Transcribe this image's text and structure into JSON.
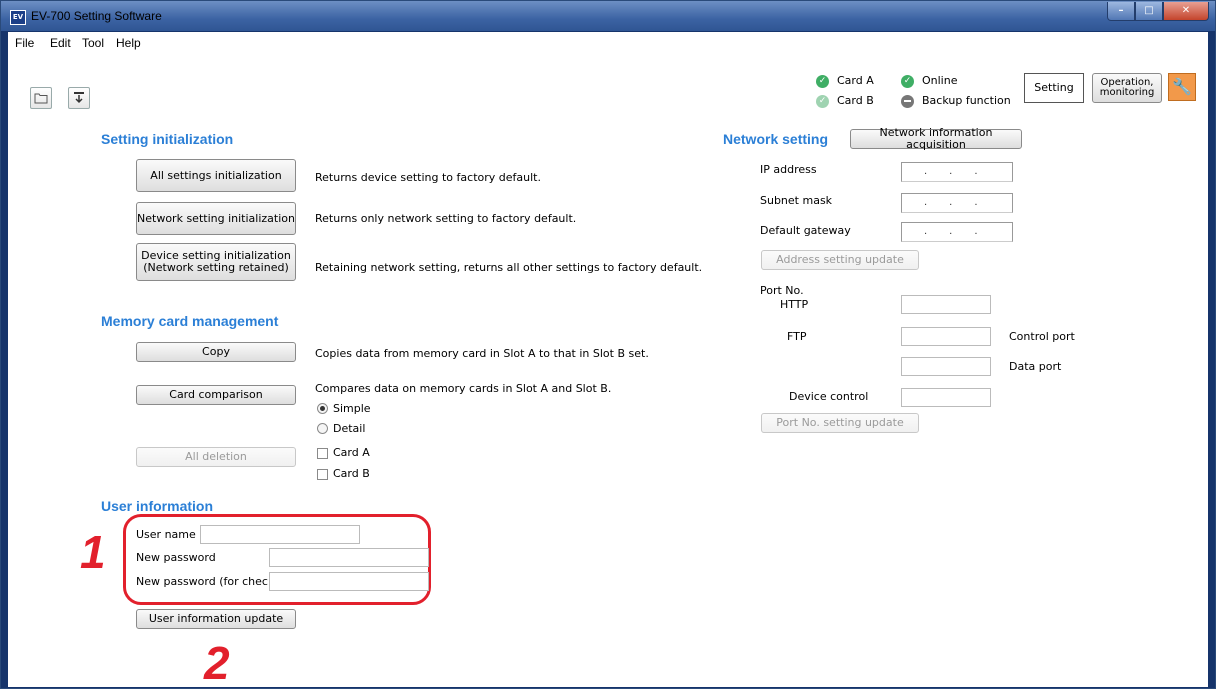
{
  "window": {
    "title": "EV-700 Setting Software",
    "icon_text": "EV"
  },
  "menu": [
    "File",
    "Edit",
    "Tool",
    "Help"
  ],
  "status": {
    "card_a": "Card A",
    "card_b": "Card B",
    "online": "Online",
    "backup": "Backup function"
  },
  "tabs": {
    "setting": "Setting",
    "operation": "Operation,\nmonitoring"
  },
  "setting_init": {
    "heading": "Setting initialization",
    "all_btn": "All settings initialization",
    "all_desc": "Returns device setting to factory default.",
    "net_btn": "Network setting initialization",
    "net_desc": "Returns only network setting to factory default.",
    "dev_btn": "Device setting initialization\n(Network setting retained)",
    "dev_desc": "Retaining network setting, returns all other settings to factory default."
  },
  "memory": {
    "heading": "Memory card management",
    "copy_btn": "Copy",
    "copy_desc": "Copies data from memory card in Slot A to that in Slot B set.",
    "compare_btn": "Card comparison",
    "compare_desc": "Compares data on memory cards in Slot A and Slot B.",
    "simple": "Simple",
    "detail": "Detail",
    "delete_btn": "All deletion",
    "card_a": "Card A",
    "card_b": "Card B"
  },
  "user": {
    "heading": "User information",
    "name_label": "User name",
    "new_pw_label": "New password",
    "check_pw_label": "New password (for check)",
    "update_btn": "User information update"
  },
  "network": {
    "heading": "Network setting",
    "acquire_btn": "Network information acquisition",
    "ip_label": "IP address",
    "subnet_label": "Subnet mask",
    "gateway_label": "Default gateway",
    "ip_value": "...",
    "address_update_btn": "Address setting update",
    "port_label": "Port No.",
    "http_label": "HTTP",
    "ftp_label": "FTP",
    "control_port": "Control port",
    "data_port": "Data port",
    "device_control": "Device control",
    "port_update_btn": "Port No. setting update"
  },
  "annotations": {
    "one": "1",
    "two": "2"
  },
  "colors": {
    "heading": "#2b7fd6",
    "annotation": "#e2202c",
    "titlebar": "#3c63a3"
  }
}
